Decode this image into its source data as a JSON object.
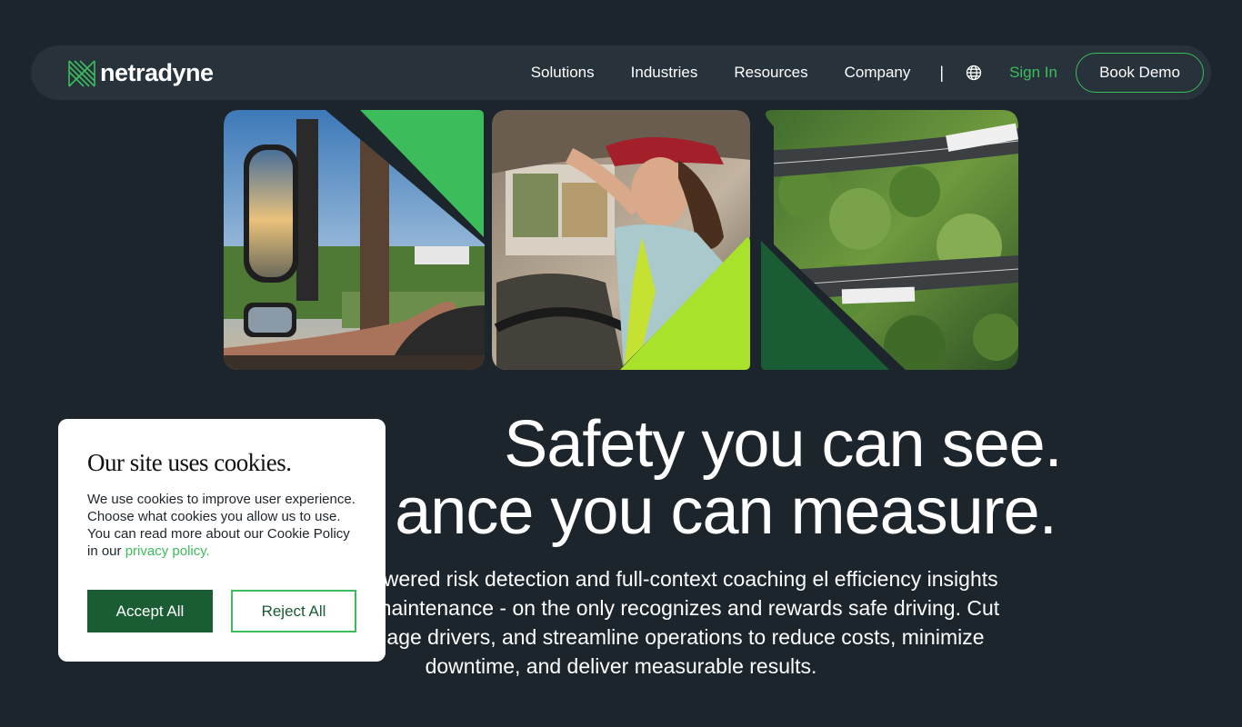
{
  "brand": {
    "name": "netradyne",
    "accent": "#3dbc5c",
    "dark_green": "#1a5c34",
    "lime": "#a8e22a",
    "background": "#1d252c"
  },
  "nav": {
    "items": [
      {
        "label": "Solutions"
      },
      {
        "label": "Industries"
      },
      {
        "label": "Resources"
      },
      {
        "label": "Company"
      }
    ],
    "divider": "|",
    "globe_icon": "globe-icon",
    "sign_in": "Sign In",
    "book_demo": "Book Demo"
  },
  "hero": {
    "images": [
      {
        "subject": "truck side mirror with hand on steering wheel"
      },
      {
        "subject": "woman driver in red cap adjusting mirror"
      },
      {
        "subject": "aerial view of trucks on forest road"
      }
    ],
    "headline_line1": "Safety you can see.",
    "headline_line2": "ance you can measure.",
    "subtext": "th instant AI-powered risk detection and full-context coaching el efficiency insights and proactive maintenance - on the only recognizes and rewards safe driving. Cut incidents, engage drivers, and streamline operations to reduce costs, minimize downtime, and deliver measurable results."
  },
  "cookie": {
    "title": "Our site uses cookies.",
    "body": "We use cookies to improve user experience. Choose what cookies you allow us to use. You can read more about our Cookie Policy in our ",
    "link": "privacy policy.",
    "accept": "Accept All",
    "reject": "Reject All"
  }
}
